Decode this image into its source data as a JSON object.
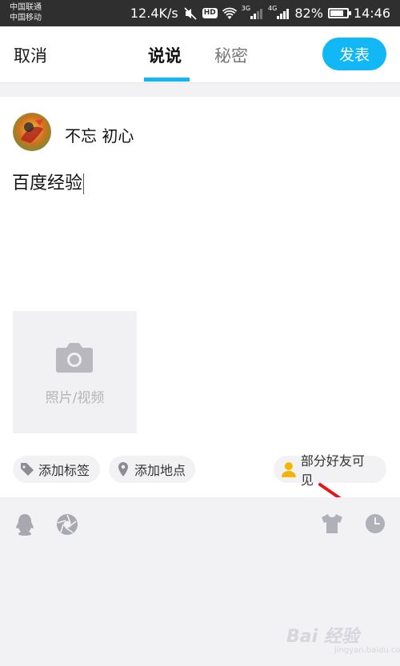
{
  "status_bar": {
    "carrier_1": "中国联通",
    "carrier_2": "中国移动",
    "net_speed": "12.4K/s",
    "hd_label": "HD",
    "sim1_net": "3G",
    "sim2_net": "4G",
    "battery": "82%",
    "battery_level": 0.82,
    "time": "14:46",
    "icons": [
      "mute-icon",
      "hd-icon",
      "wifi-icon",
      "signal-icon",
      "signal-icon",
      "battery-icon"
    ]
  },
  "header": {
    "cancel_label": "取消",
    "tabs": [
      {
        "label": "说说",
        "active": true
      },
      {
        "label": "秘密",
        "active": false
      }
    ],
    "publish_label": "发表"
  },
  "composer": {
    "username": "不忘 初心",
    "text": "百度经验",
    "photo_label": "照片/视频"
  },
  "chips": {
    "add_tag": "添加标签",
    "add_location": "添加地点",
    "visibility": "部分好友可见"
  },
  "toolbar": {
    "icons": [
      "qq-icon",
      "shutter-icon",
      "shirt-icon",
      "clock-icon"
    ]
  },
  "watermark": {
    "text": "Bai 经验",
    "sub": "jingyan.baidu.com"
  },
  "colors": {
    "accent": "#12b7f5",
    "annotation_arrow": "#e8161a",
    "visibility_icon": "#f5b400"
  }
}
